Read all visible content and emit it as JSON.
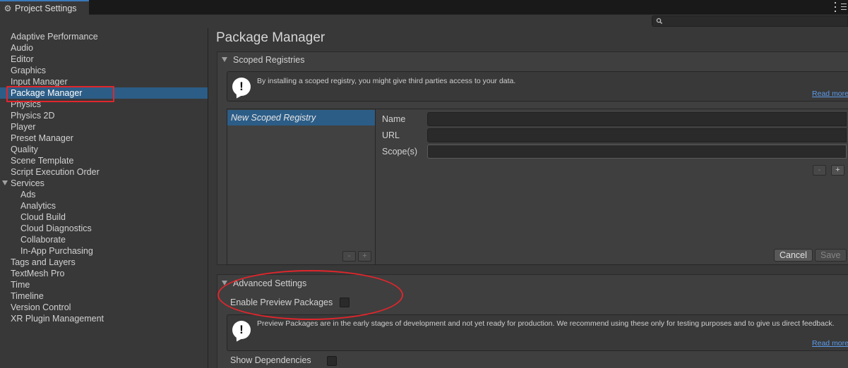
{
  "window": {
    "tab_title": "Project Settings",
    "tab_icon": "gear-icon"
  },
  "search": {
    "icon": "search-icon",
    "value": ""
  },
  "sidebar": {
    "items": [
      {
        "label": "Adaptive Performance"
      },
      {
        "label": "Audio"
      },
      {
        "label": "Editor"
      },
      {
        "label": "Graphics"
      },
      {
        "label": "Input Manager"
      },
      {
        "label": "Package Manager",
        "selected": true
      },
      {
        "label": "Physics"
      },
      {
        "label": "Physics 2D"
      },
      {
        "label": "Player"
      },
      {
        "label": "Preset Manager"
      },
      {
        "label": "Quality"
      },
      {
        "label": "Scene Template"
      },
      {
        "label": "Script Execution Order"
      },
      {
        "label": "Services",
        "expanded": true
      },
      {
        "label": "Ads",
        "child": true
      },
      {
        "label": "Analytics",
        "child": true
      },
      {
        "label": "Cloud Build",
        "child": true
      },
      {
        "label": "Cloud Diagnostics",
        "child": true
      },
      {
        "label": "Collaborate",
        "child": true
      },
      {
        "label": "In-App Purchasing",
        "child": true
      },
      {
        "label": "Tags and Layers"
      },
      {
        "label": "TextMesh Pro"
      },
      {
        "label": "Time"
      },
      {
        "label": "Timeline"
      },
      {
        "label": "Version Control"
      },
      {
        "label": "XR Plugin Management"
      }
    ]
  },
  "main": {
    "title": "Package Manager",
    "scoped_registries": {
      "header": "Scoped Registries",
      "help_text": "By installing a scoped registry, you might give third parties access to your data.",
      "read_more": "Read more",
      "registry_item": "New Scoped Registry",
      "fields": {
        "name_label": "Name",
        "name_value": "",
        "url_label": "URL",
        "url_value": "",
        "scopes_label": "Scope(s)",
        "scopes_value": ""
      },
      "minus": "-",
      "plus": "+",
      "cancel": "Cancel",
      "save": "Save"
    },
    "advanced_settings": {
      "header": "Advanced Settings",
      "enable_preview_label": "Enable Preview Packages",
      "enable_preview_checked": false,
      "help_text": "Preview Packages are in the early stages of development and not yet ready for production. We recommend using these only for testing purposes and to give us direct feedback.",
      "read_more": "Read more",
      "show_dependencies_label": "Show Dependencies",
      "show_dependencies_checked": false
    }
  },
  "colors": {
    "selection": "#2c5d87",
    "annotation_red": "#e0262c",
    "link": "#5c9ceb"
  }
}
